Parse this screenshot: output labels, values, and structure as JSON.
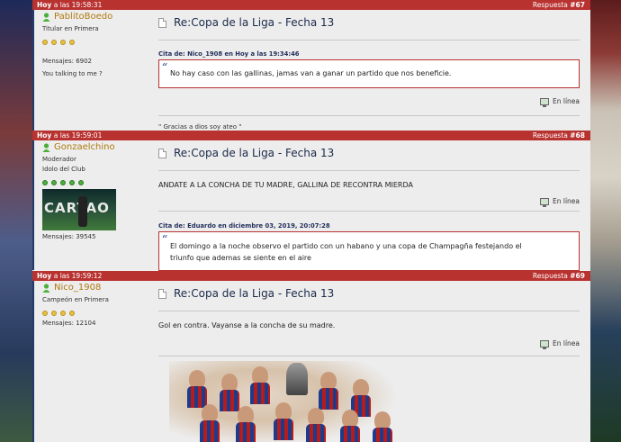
{
  "posts": [
    {
      "time_prefix": "Hoy",
      "time_rest": " a las 19:58:31",
      "reply_label": "Respuesta ",
      "reply_num": "#67",
      "username": "PablitoBoedo",
      "rank1": "Titular en Primera",
      "rank2": "",
      "stars": 4,
      "messages": "Mensajes: 6902",
      "motto": "You talking to me ?",
      "title": "Re:Copa de la Liga - Fecha 13",
      "quote_header": "Cita de: Nico_1908 en Hoy a las 19:34:46",
      "quote_text": "No hay caso con las gallinas, jamas van a ganar un partido que nos beneficie.",
      "online": "En línea",
      "signature": "\" Gracias a dios soy ateo \""
    },
    {
      "time_prefix": "Hoy",
      "time_rest": " a las 19:59:01",
      "reply_label": "Respuesta ",
      "reply_num": "#68",
      "username": "Gonzaelchino",
      "rank1": "Moderador",
      "rank2": "Idolo del Club",
      "stars": 5,
      "avatar_text": "CARTAO",
      "messages": "Mensajes: 39545",
      "title": "Re:Copa de la Liga - Fecha 13",
      "message": "ANDATE A LA CONCHA DE TU MADRE, GALLINA DE RECONTRA MIERDA",
      "online": "En línea",
      "quote_header": "Cita de: Eduardo en diciembre 03, 2019, 20:07:28",
      "quote_line1": "El domingo a la noche observo el partido con un habano y una copa de Champagña festejando el",
      "quote_line2": "triunfo que ademas se siente en el aire"
    },
    {
      "time_prefix": "Hoy",
      "time_rest": " a las 19:59:12",
      "reply_label": "Respuesta ",
      "reply_num": "#69",
      "username": "Nico_1908",
      "rank1": "Campeón en Primera",
      "stars": 4,
      "messages": "Mensajes: 12104",
      "title": "Re:Copa de la Liga - Fecha 13",
      "message": "Gol en contra. Vayanse a la concha de su madre.",
      "online": "En línea"
    }
  ],
  "colors": {
    "header_red": "#b83230",
    "username_gold": "#b07a10",
    "star_gold": "#e7c23c",
    "star_green": "#4caf3a",
    "quote_border": "#b83230",
    "quote_header_blue": "#1f2d5a"
  },
  "icons": [
    "user-online-icon",
    "document-icon",
    "quote-mark-icon",
    "monitor-online-icon"
  ]
}
